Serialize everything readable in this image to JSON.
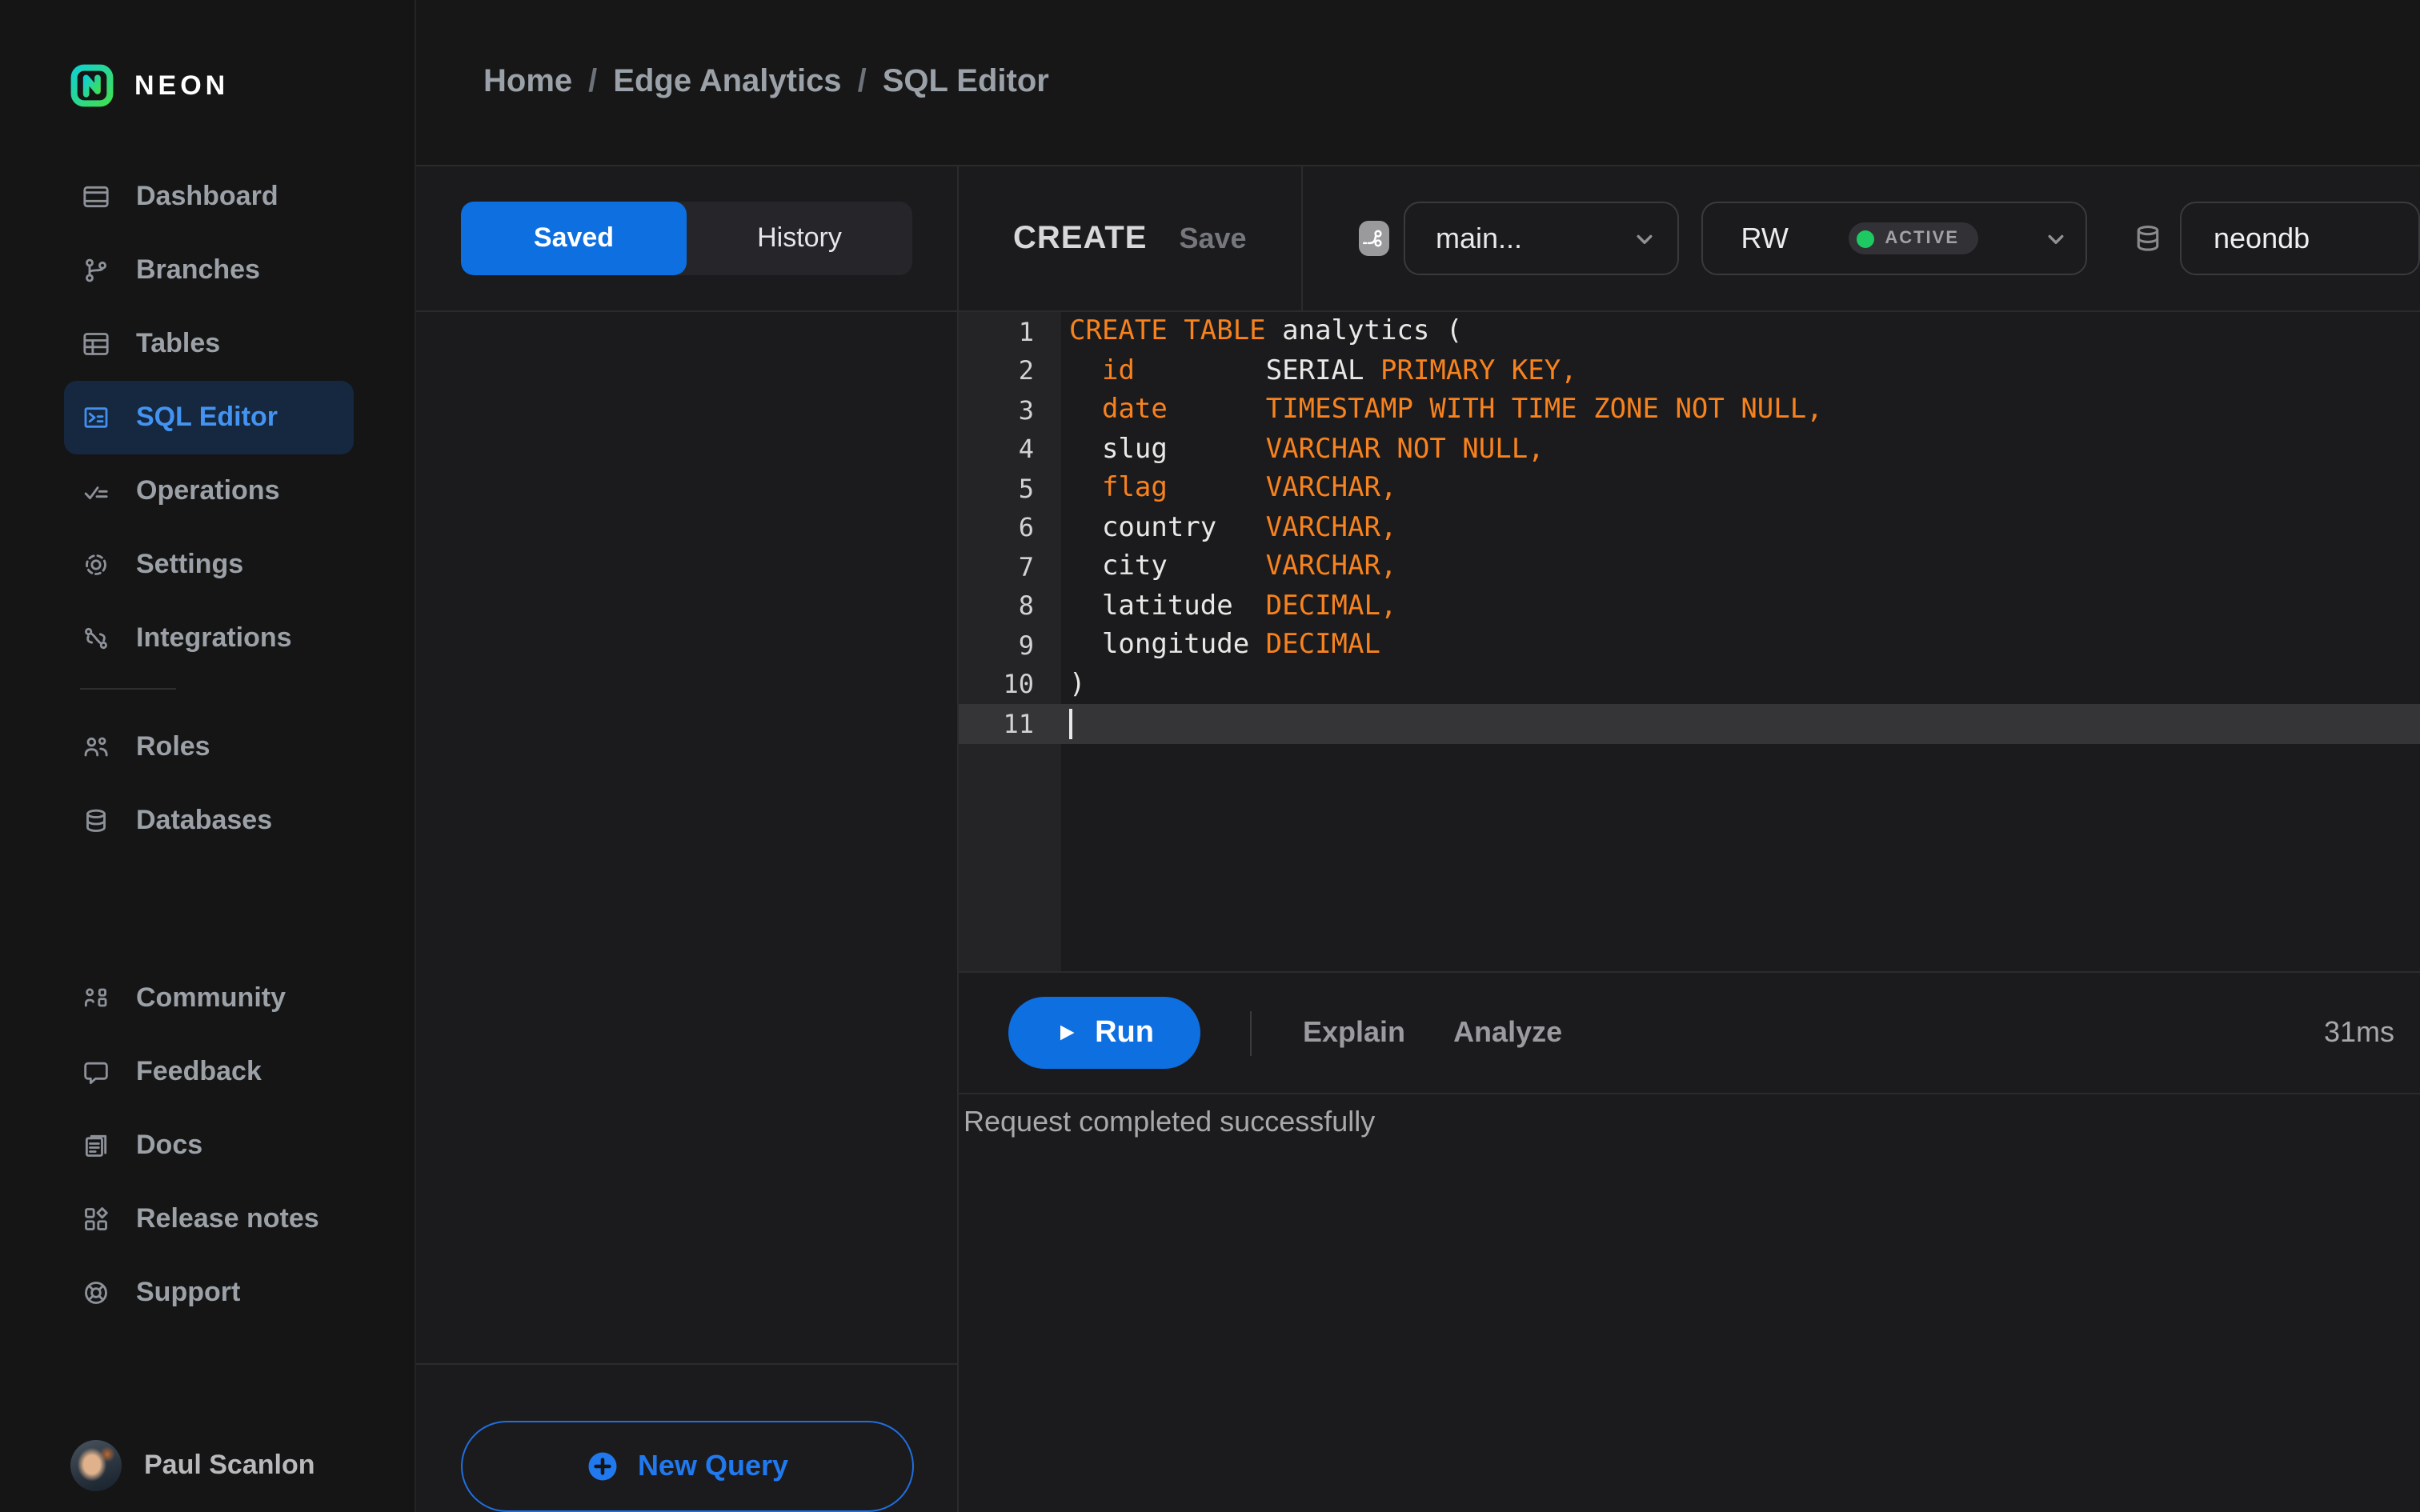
{
  "sidebar": {
    "logo_text": "NEON",
    "sections": [
      {
        "items": [
          {
            "id": "dashboard",
            "label": "Dashboard",
            "icon": "dashboard-icon",
            "active": false
          },
          {
            "id": "branches",
            "label": "Branches",
            "icon": "branches-icon",
            "active": false
          },
          {
            "id": "tables",
            "label": "Tables",
            "icon": "tables-icon",
            "active": false
          },
          {
            "id": "sql-editor",
            "label": "SQL Editor",
            "icon": "sql-editor-icon",
            "active": true
          },
          {
            "id": "operations",
            "label": "Operations",
            "icon": "operations-icon",
            "active": false
          },
          {
            "id": "settings",
            "label": "Settings",
            "icon": "settings-icon",
            "active": false
          },
          {
            "id": "integrations",
            "label": "Integrations",
            "icon": "integrations-icon",
            "active": false
          }
        ]
      },
      {
        "items": [
          {
            "id": "roles",
            "label": "Roles",
            "icon": "roles-icon",
            "active": false
          },
          {
            "id": "databases",
            "label": "Databases",
            "icon": "databases-icon",
            "active": false
          }
        ]
      },
      {
        "items": [
          {
            "id": "community",
            "label": "Community",
            "icon": "community-icon",
            "active": false
          },
          {
            "id": "feedback",
            "label": "Feedback",
            "icon": "feedback-icon",
            "active": false
          },
          {
            "id": "docs",
            "label": "Docs",
            "icon": "docs-icon",
            "active": false
          },
          {
            "id": "release-notes",
            "label": "Release notes",
            "icon": "release-notes-icon",
            "active": false
          },
          {
            "id": "support",
            "label": "Support",
            "icon": "support-icon",
            "active": false
          }
        ]
      }
    ],
    "user": {
      "name": "Paul Scanlon"
    }
  },
  "breadcrumb": {
    "items": [
      "Home",
      "Edge Analytics",
      "SQL Editor"
    ],
    "separator": "/"
  },
  "queries_panel": {
    "tabs": [
      {
        "label": "Saved",
        "active": true
      },
      {
        "label": "History",
        "active": false
      }
    ],
    "new_query_label": "New Query"
  },
  "editor": {
    "header": {
      "title": "CREATE",
      "save_label": "Save",
      "branch": "main...",
      "endpoint": "RW",
      "endpoint_status": "ACTIVE",
      "database": "neondb"
    },
    "code": {
      "lines": [
        {
          "n": 1,
          "cursor": false,
          "segments": [
            {
              "c": "kw",
              "t": "CREATE TABLE"
            },
            {
              "c": "pl",
              "t": " analytics ("
            }
          ]
        },
        {
          "n": 2,
          "cursor": false,
          "segments": [
            {
              "c": "pl",
              "t": "  "
            },
            {
              "c": "kw",
              "t": "id"
            },
            {
              "c": "pl",
              "t": "        SERIAL "
            },
            {
              "c": "kw",
              "t": "PRIMARY KEY,"
            }
          ]
        },
        {
          "n": 3,
          "cursor": false,
          "segments": [
            {
              "c": "pl",
              "t": "  "
            },
            {
              "c": "kw",
              "t": "date"
            },
            {
              "c": "pl",
              "t": "      "
            },
            {
              "c": "kw",
              "t": "TIMESTAMP WITH TIME ZONE NOT NULL,"
            }
          ]
        },
        {
          "n": 4,
          "cursor": false,
          "segments": [
            {
              "c": "pl",
              "t": "  slug      "
            },
            {
              "c": "kw",
              "t": "VARCHAR NOT NULL,"
            }
          ]
        },
        {
          "n": 5,
          "cursor": false,
          "segments": [
            {
              "c": "pl",
              "t": "  "
            },
            {
              "c": "kw",
              "t": "flag"
            },
            {
              "c": "pl",
              "t": "      "
            },
            {
              "c": "kw",
              "t": "VARCHAR,"
            }
          ]
        },
        {
          "n": 6,
          "cursor": false,
          "segments": [
            {
              "c": "pl",
              "t": "  country   "
            },
            {
              "c": "kw",
              "t": "VARCHAR,"
            }
          ]
        },
        {
          "n": 7,
          "cursor": false,
          "segments": [
            {
              "c": "pl",
              "t": "  city      "
            },
            {
              "c": "kw",
              "t": "VARCHAR,"
            }
          ]
        },
        {
          "n": 8,
          "cursor": false,
          "segments": [
            {
              "c": "pl",
              "t": "  latitude  "
            },
            {
              "c": "kw",
              "t": "DECIMAL,"
            }
          ]
        },
        {
          "n": 9,
          "cursor": false,
          "segments": [
            {
              "c": "pl",
              "t": "  longitude "
            },
            {
              "c": "kw",
              "t": "DECIMAL"
            }
          ]
        },
        {
          "n": 10,
          "cursor": false,
          "segments": [
            {
              "c": "pl",
              "t": ")"
            }
          ]
        },
        {
          "n": 11,
          "cursor": true,
          "segments": []
        }
      ]
    },
    "toolbar": {
      "run_label": "Run",
      "explain_label": "Explain",
      "analyze_label": "Analyze",
      "duration": "31ms"
    },
    "status_message": "Request completed successfully"
  },
  "colors": {
    "accent_blue": "#0d6fe0",
    "link_blue": "#2079ef",
    "active_item_blue": "#4394f0",
    "keyword_orange": "#f7821e",
    "active_green": "#1ec962",
    "sidebar_bg": "#151515",
    "panel_bg": "#1b1b1d"
  }
}
